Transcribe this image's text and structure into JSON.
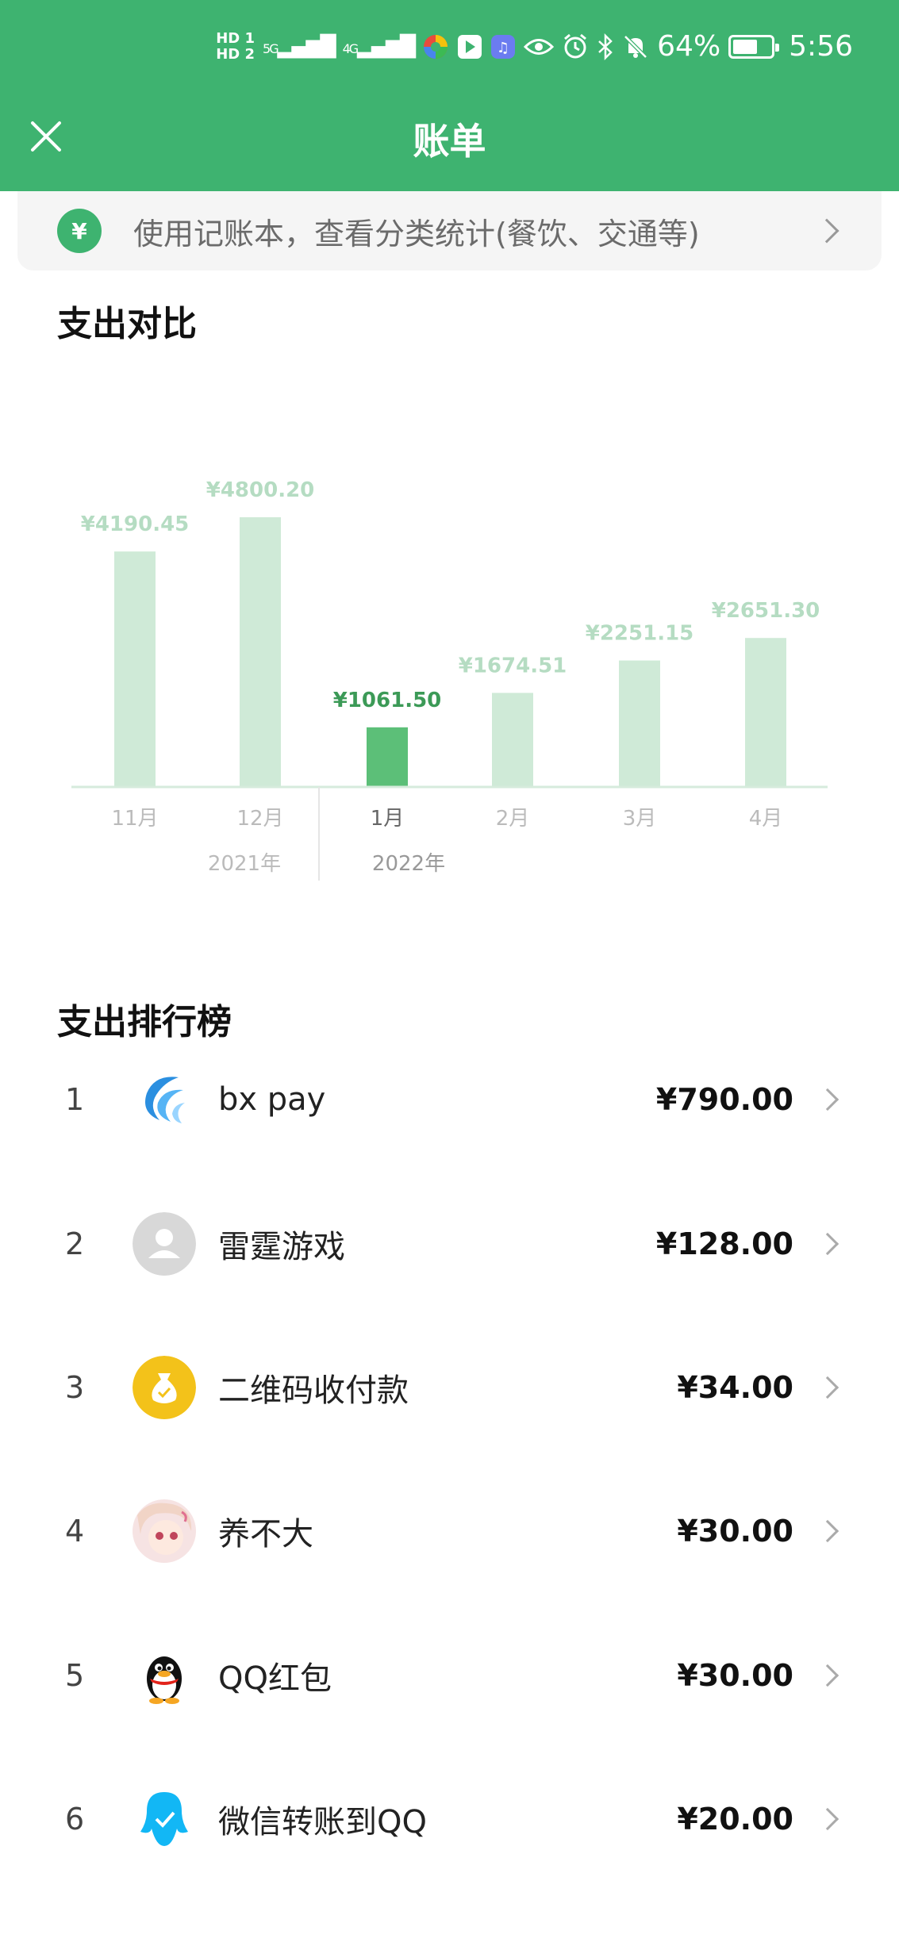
{
  "status_bar": {
    "network_1": "HD 1",
    "network_2": "HD 2",
    "signal_1": "5G",
    "signal_2": "4G",
    "battery_percent": "64%",
    "battery_level": 0.64,
    "time": "5:56",
    "icons": [
      "app-icon-multicolor",
      "app-icon-play",
      "app-icon-music",
      "eye-icon",
      "alarm-icon",
      "bluetooth-icon",
      "mute-bell-icon"
    ]
  },
  "header": {
    "title": "账单",
    "close_icon": "close-icon"
  },
  "banner": {
    "icon": "¥",
    "text": "使用记账本，查看分类统计(餐饮、交通等)"
  },
  "compare": {
    "title": "支出对比"
  },
  "chart_data": {
    "type": "bar",
    "categories": [
      "11月",
      "12月",
      "1月",
      "2月",
      "3月",
      "4月"
    ],
    "values": [
      4190.45,
      4800.2,
      1061.5,
      1674.51,
      2251.15,
      2651.3
    ],
    "value_labels": [
      "¥4190.45",
      "¥4800.20",
      "¥1061.50",
      "¥1674.51",
      "¥2251.15",
      "¥2651.30"
    ],
    "highlight_index": 2,
    "year_labels": [
      "2021年",
      "2022年"
    ],
    "colors": {
      "bar": "#cfead7",
      "bar_highlight": "#5cbf78",
      "label": "#b5dcc2",
      "label_highlight": "#3c9a57"
    }
  },
  "ranking": {
    "title": "支出排行榜",
    "items": [
      {
        "rank": "1",
        "name": "bx pay",
        "amount": "¥790.00",
        "icon": "bx-pay-logo-icon"
      },
      {
        "rank": "2",
        "name": "雷霆游戏",
        "amount": "¥128.00",
        "icon": "default-avatar-icon"
      },
      {
        "rank": "3",
        "name": "二维码收付款",
        "amount": "¥34.00",
        "icon": "money-bag-icon"
      },
      {
        "rank": "4",
        "name": "养不大",
        "amount": "¥30.00",
        "icon": "anime-avatar-icon"
      },
      {
        "rank": "5",
        "name": "QQ红包",
        "amount": "¥30.00",
        "icon": "qq-penguin-icon"
      },
      {
        "rank": "6",
        "name": "微信转账到QQ",
        "amount": "¥20.00",
        "icon": "qq-wallet-icon"
      }
    ]
  }
}
